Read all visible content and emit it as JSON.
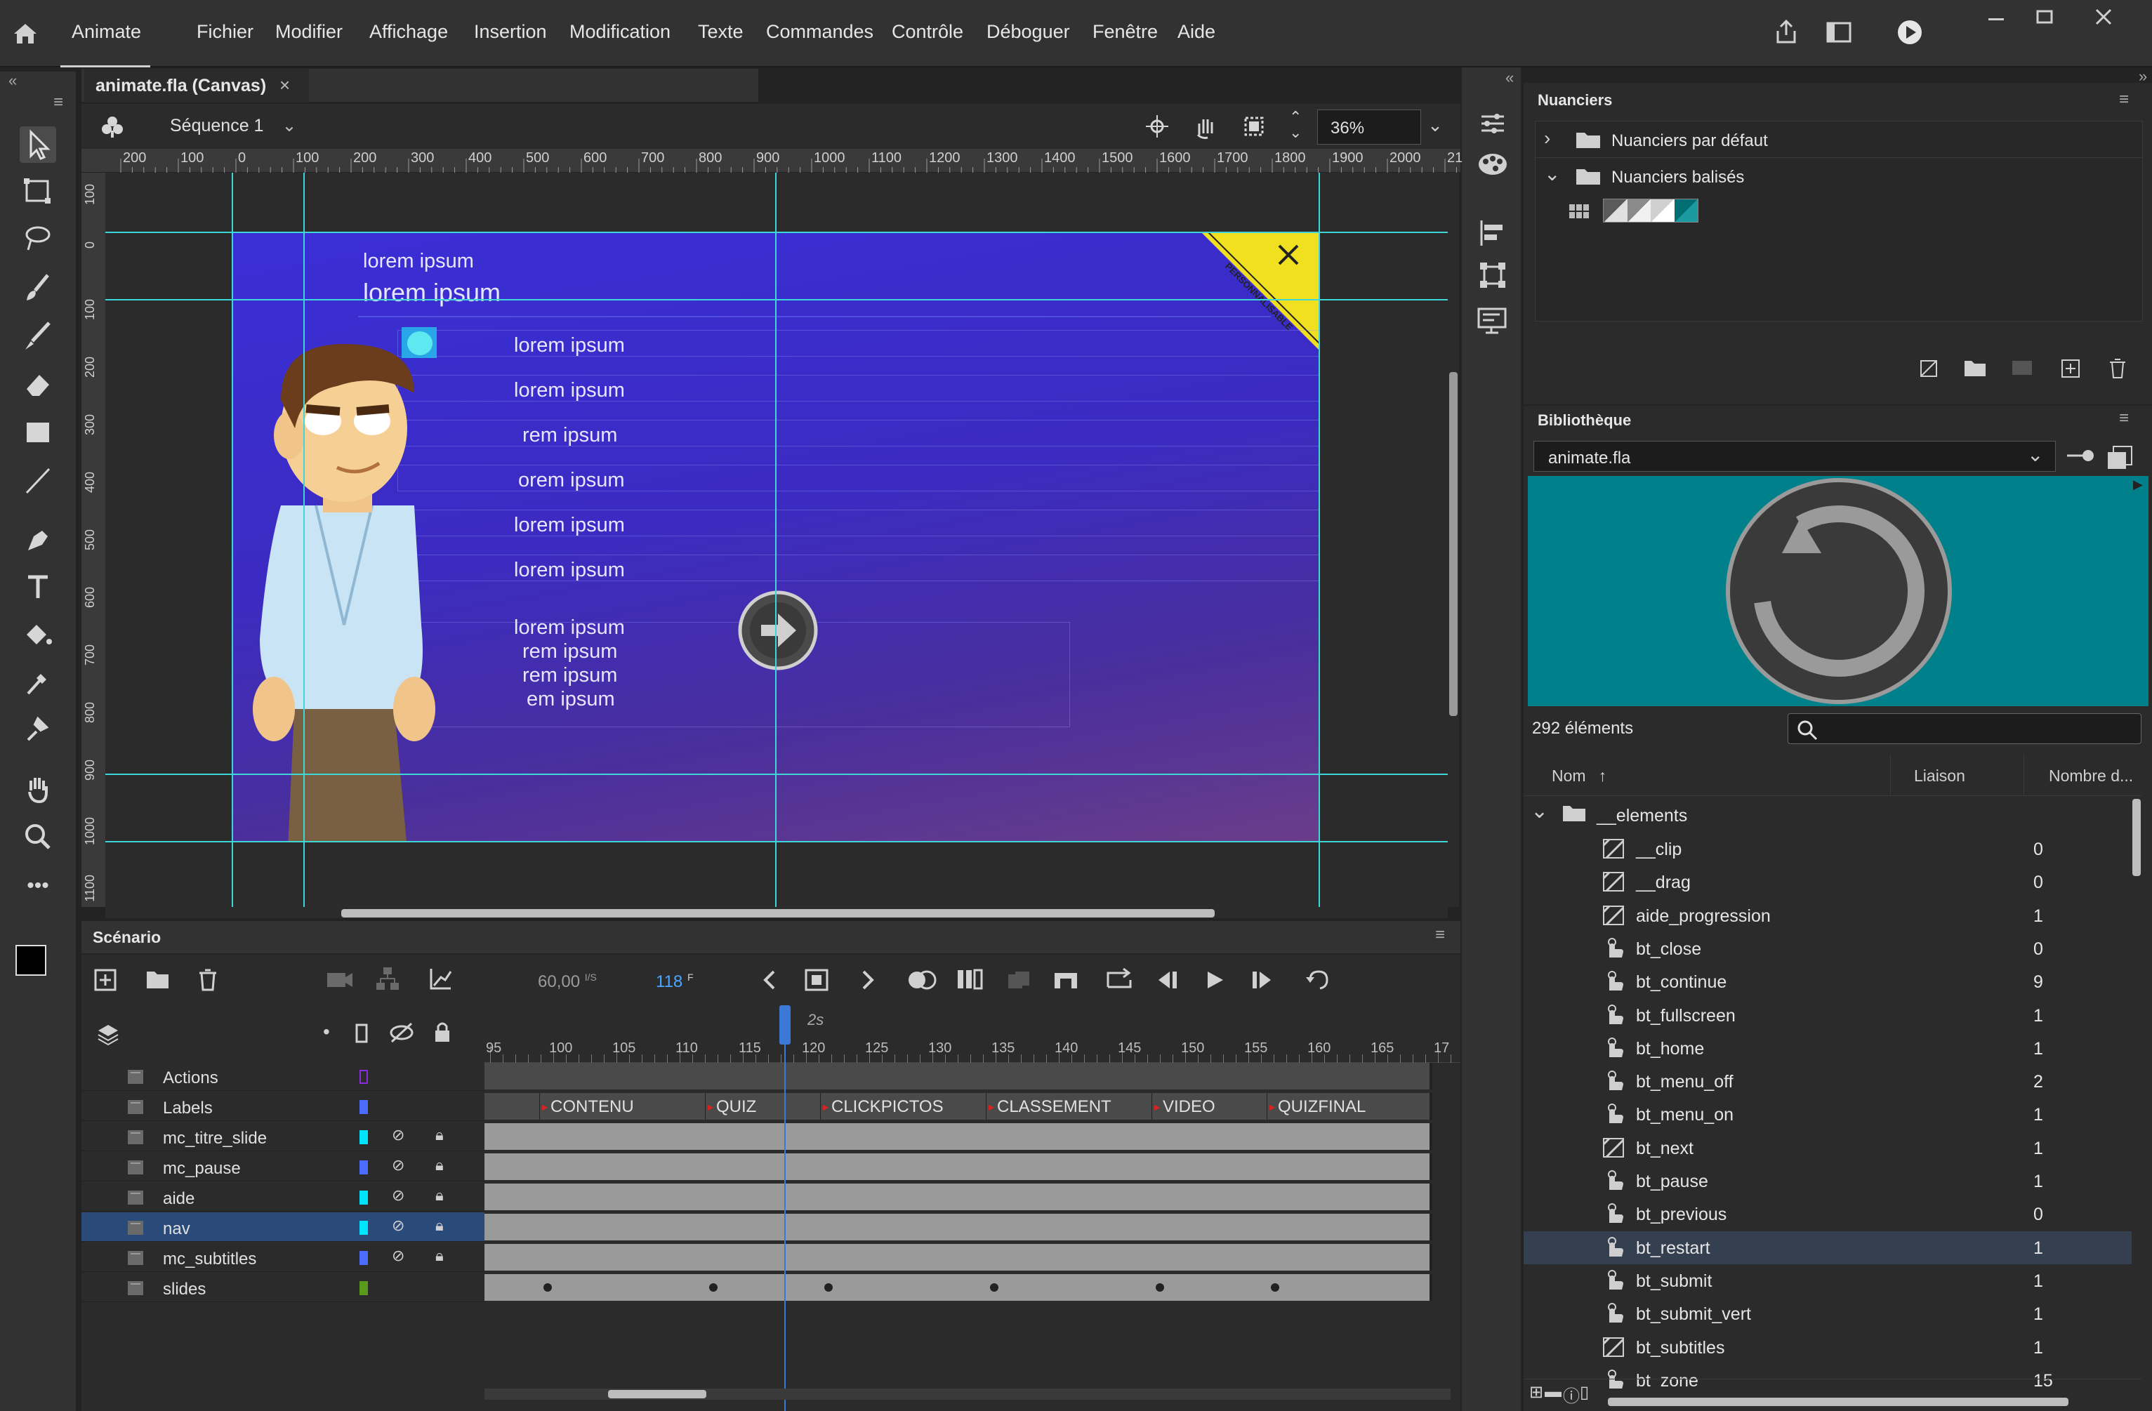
{
  "app": {
    "name": "Animate"
  },
  "menu": [
    "Fichier",
    "Modifier",
    "Affichage",
    "Insertion",
    "Modification",
    "Texte",
    "Commandes",
    "Contrôle",
    "Déboguer",
    "Fenêtre",
    "Aide"
  ],
  "document": {
    "tab_title": "animate.fla (Canvas)",
    "scene": "Séquence 1",
    "zoom": "36%"
  },
  "ruler_h": [
    "200",
    "100",
    "0",
    "100",
    "200",
    "300",
    "400",
    "500",
    "600",
    "700",
    "800",
    "900",
    "1000",
    "1100",
    "1200",
    "1300",
    "1400",
    "1500",
    "1600",
    "1700",
    "1800",
    "1900",
    "2000",
    "2100"
  ],
  "ruler_v": [
    "100",
    "0",
    "100",
    "200",
    "300",
    "400",
    "500",
    "600",
    "700",
    "800",
    "900",
    "1000",
    "1100"
  ],
  "stage": {
    "title_small": "lorem ipsum",
    "title_large": "lorem ipsum",
    "items": [
      "lorem ipsum",
      "lorem ipsum",
      "rem ipsum",
      "orem ipsum",
      "lorem ipsum",
      "lorem ipsum"
    ],
    "block": [
      "lorem ipsum",
      "rem ipsum",
      "rem ipsum",
      "em ipsum"
    ],
    "badge": "PERSONNALISABLE"
  },
  "timeline": {
    "title": "Scénario",
    "fps": "60,00",
    "fps_unit": "I/S",
    "frame": "118",
    "frame_unit": "F",
    "time_label": "2s",
    "ruler": [
      "95",
      "100",
      "105",
      "110",
      "115",
      "120",
      "125",
      "130",
      "135",
      "140",
      "145",
      "150",
      "155",
      "160",
      "165",
      "17"
    ],
    "layers": [
      {
        "name": "Actions",
        "color": "#8a2be2"
      },
      {
        "name": "Labels",
        "color": "#4a6cff"
      },
      {
        "name": "mc_titre_slide",
        "color": "#00e5ff"
      },
      {
        "name": "mc_pause",
        "color": "#4a6cff"
      },
      {
        "name": "aide",
        "color": "#00e5ff"
      },
      {
        "name": "nav",
        "color": "#00e5ff"
      },
      {
        "name": "mc_subtitles",
        "color": "#4a6cff"
      },
      {
        "name": "slides",
        "color": "#5a9a1a"
      }
    ],
    "frame_labels": [
      "CONTENU",
      "QUIZ",
      "CLICKPICTOS",
      "CLASSEMENT",
      "VIDEO",
      "QUIZFINAL"
    ]
  },
  "swatches": {
    "title": "Nuanciers",
    "default_folder": "Nuanciers par défaut",
    "tagged_folder": "Nuanciers balisés"
  },
  "library": {
    "title": "Bibliothèque",
    "file": "animate.fla",
    "count": "292 éléments",
    "col_name": "Nom",
    "col_link": "Liaison",
    "col_uses": "Nombre d...",
    "folder": "__elements",
    "items": [
      {
        "name": "__clip",
        "count": "0",
        "kind": "movie"
      },
      {
        "name": "__drag",
        "count": "0",
        "kind": "movie"
      },
      {
        "name": "aide_progression",
        "count": "1",
        "kind": "movie"
      },
      {
        "name": "bt_close",
        "count": "0",
        "kind": "button"
      },
      {
        "name": "bt_continue",
        "count": "9",
        "kind": "button"
      },
      {
        "name": "bt_fullscreen",
        "count": "1",
        "kind": "button"
      },
      {
        "name": "bt_home",
        "count": "1",
        "kind": "button"
      },
      {
        "name": "bt_menu_off",
        "count": "2",
        "kind": "button"
      },
      {
        "name": "bt_menu_on",
        "count": "1",
        "kind": "button"
      },
      {
        "name": "bt_next",
        "count": "1",
        "kind": "movie"
      },
      {
        "name": "bt_pause",
        "count": "1",
        "kind": "button"
      },
      {
        "name": "bt_previous",
        "count": "0",
        "kind": "button"
      },
      {
        "name": "bt_restart",
        "count": "1",
        "kind": "button"
      },
      {
        "name": "bt_submit",
        "count": "1",
        "kind": "button"
      },
      {
        "name": "bt_submit_vert",
        "count": "1",
        "kind": "button"
      },
      {
        "name": "bt_subtitles",
        "count": "1",
        "kind": "movie"
      },
      {
        "name": "bt_zone",
        "count": "15",
        "kind": "button"
      }
    ]
  },
  "colors": {
    "accent": "#3fd6d8",
    "selection": "#2a4a7a",
    "preview_bg": "#00808a"
  }
}
